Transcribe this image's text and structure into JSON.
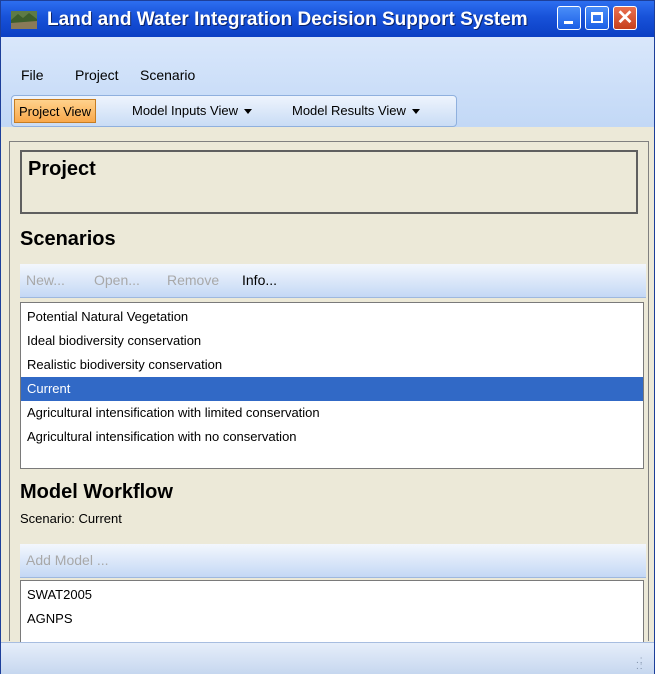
{
  "window": {
    "title": "Land and Water Integration Decision Support System"
  },
  "menu": {
    "items": [
      "File",
      "Project",
      "Scenario"
    ]
  },
  "views": {
    "project": "Project View",
    "model_inputs": "Model Inputs View",
    "model_results": "Model Results View",
    "active": "Project View"
  },
  "project": {
    "heading": "Project"
  },
  "scenarios": {
    "heading": "Scenarios",
    "toolbar": {
      "new": "New...",
      "open": "Open...",
      "remove": "Remove",
      "info": "Info..."
    },
    "items": [
      "Potential Natural Vegetation",
      "Ideal biodiversity conservation",
      "Realistic biodiversity conservation",
      "Current",
      "Agricultural intensification with limited conservation",
      "Agricultural intensification with no conservation"
    ],
    "selected": "Current"
  },
  "workflow": {
    "heading": "Model Workflow",
    "scenario_label": "Scenario: Current",
    "add_model": "Add Model ...",
    "models": [
      "SWAT2005",
      "AGNPS"
    ]
  },
  "colors": {
    "title_bar": "#1751d8",
    "selection": "#3169c6",
    "active_view": "#f9a84a",
    "panel_bg": "#ece9d8"
  }
}
